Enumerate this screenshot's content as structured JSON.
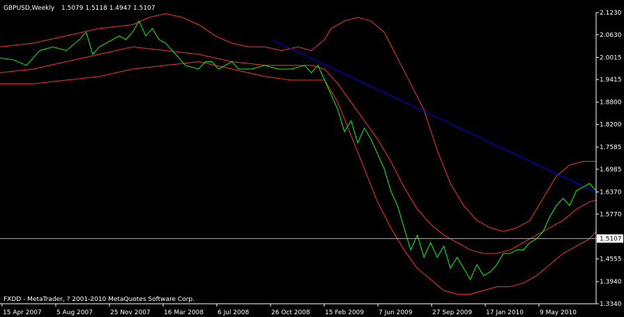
{
  "header": {
    "symbol": "GBPUSD,Weekly",
    "ohlc": "1.5079 1.5118 1.4947 1.5107"
  },
  "footer": {
    "copyright": "FXDD - MetaTrader, ? 2001-2010 MetaQuotes Software Corp."
  },
  "colors": {
    "background": "#000000",
    "price_line": "#00ff00",
    "bands": "#ff3030",
    "trendline": "#0000ff",
    "axis": "#ffffff"
  },
  "chart_data": {
    "type": "line",
    "ylim": [
      1.334,
      2.123
    ],
    "y_ticks": [
      "2.1230",
      "2.0630",
      "2.0015",
      "1.9415",
      "1.8800",
      "1.8200",
      "1.7585",
      "1.6985",
      "1.6370",
      "1.5770",
      "1.5107",
      "1.4555",
      "1.3940",
      "1.3340"
    ],
    "current_price": 1.5107,
    "current_price_label": "1.5107",
    "x_ticks": [
      "15 Apr 2007",
      "5 Aug 2007",
      "25 Nov 2007",
      "16 Mar 2008",
      "6 Jul 2008",
      "26 Oct 2008",
      "15 Feb 2009",
      "7 Jun 2009",
      "27 Sep 2009",
      "17 Jan 2010",
      "9 May 2010"
    ],
    "n_bars": 180,
    "series": [
      {
        "role": "price",
        "points": [
          [
            0,
            2.0
          ],
          [
            4,
            1.995
          ],
          [
            8,
            1.98
          ],
          [
            12,
            2.02
          ],
          [
            16,
            2.03
          ],
          [
            20,
            2.02
          ],
          [
            24,
            2.05
          ],
          [
            26,
            2.07
          ],
          [
            28,
            2.01
          ],
          [
            30,
            2.03
          ],
          [
            34,
            2.05
          ],
          [
            36,
            2.06
          ],
          [
            38,
            2.05
          ],
          [
            40,
            2.07
          ],
          [
            42,
            2.1
          ],
          [
            44,
            2.06
          ],
          [
            46,
            2.08
          ],
          [
            48,
            2.05
          ],
          [
            50,
            2.04
          ],
          [
            52,
            2.02
          ],
          [
            56,
            1.98
          ],
          [
            60,
            1.97
          ],
          [
            62,
            1.99
          ],
          [
            64,
            1.99
          ],
          [
            66,
            1.97
          ],
          [
            68,
            1.98
          ],
          [
            70,
            1.99
          ],
          [
            72,
            1.97
          ],
          [
            76,
            1.97
          ],
          [
            80,
            1.98
          ],
          [
            84,
            1.97
          ],
          [
            88,
            1.97
          ],
          [
            92,
            1.98
          ],
          [
            94,
            1.96
          ],
          [
            96,
            1.98
          ],
          [
            98,
            1.94
          ],
          [
            100,
            1.9
          ],
          [
            102,
            1.86
          ],
          [
            104,
            1.8
          ],
          [
            106,
            1.83
          ],
          [
            108,
            1.77
          ],
          [
            110,
            1.81
          ],
          [
            112,
            1.78
          ],
          [
            114,
            1.74
          ],
          [
            116,
            1.7
          ],
          [
            118,
            1.64
          ],
          [
            120,
            1.6
          ],
          [
            122,
            1.54
          ],
          [
            124,
            1.48
          ],
          [
            126,
            1.52
          ],
          [
            128,
            1.46
          ],
          [
            130,
            1.5
          ],
          [
            132,
            1.46
          ],
          [
            134,
            1.49
          ],
          [
            136,
            1.43
          ],
          [
            138,
            1.46
          ],
          [
            140,
            1.43
          ],
          [
            142,
            1.4
          ],
          [
            144,
            1.44
          ],
          [
            146,
            1.41
          ],
          [
            148,
            1.42
          ],
          [
            150,
            1.44
          ],
          [
            152,
            1.47
          ],
          [
            154,
            1.47
          ],
          [
            156,
            1.48
          ],
          [
            158,
            1.48
          ],
          [
            160,
            1.5
          ],
          [
            162,
            1.51
          ],
          [
            164,
            1.53
          ],
          [
            166,
            1.57
          ],
          [
            168,
            1.6
          ],
          [
            170,
            1.62
          ],
          [
            172,
            1.6
          ],
          [
            174,
            1.64
          ],
          [
            176,
            1.65
          ],
          [
            178,
            1.66
          ],
          [
            180,
            1.64
          ],
          [
            182,
            1.63
          ],
          [
            184,
            1.66
          ],
          [
            186,
            1.65
          ],
          [
            188,
            1.61
          ],
          [
            190,
            1.64
          ],
          [
            192,
            1.66
          ],
          [
            194,
            1.65
          ],
          [
            196,
            1.63
          ],
          [
            198,
            1.62
          ],
          [
            200,
            1.66
          ],
          [
            202,
            1.67
          ],
          [
            204,
            1.65
          ],
          [
            206,
            1.64
          ],
          [
            208,
            1.62
          ],
          [
            210,
            1.63
          ],
          [
            212,
            1.64
          ],
          [
            214,
            1.6
          ],
          [
            216,
            1.58
          ],
          [
            218,
            1.56
          ],
          [
            220,
            1.52
          ],
          [
            222,
            1.5
          ],
          [
            224,
            1.53
          ],
          [
            226,
            1.54
          ],
          [
            228,
            1.52
          ],
          [
            230,
            1.48
          ],
          [
            232,
            1.47
          ],
          [
            234,
            1.46
          ],
          [
            236,
            1.47
          ],
          [
            238,
            1.51
          ],
          [
            240,
            1.52
          ],
          [
            242,
            1.51
          ]
        ]
      },
      {
        "role": "upper-band",
        "points": [
          [
            0,
            2.03
          ],
          [
            10,
            2.04
          ],
          [
            20,
            2.06
          ],
          [
            30,
            2.08
          ],
          [
            40,
            2.09
          ],
          [
            45,
            2.11
          ],
          [
            50,
            2.12
          ],
          [
            55,
            2.11
          ],
          [
            60,
            2.09
          ],
          [
            65,
            2.06
          ],
          [
            70,
            2.04
          ],
          [
            75,
            2.03
          ],
          [
            80,
            2.03
          ],
          [
            85,
            2.02
          ],
          [
            90,
            2.03
          ],
          [
            94,
            2.02
          ],
          [
            98,
            2.05
          ],
          [
            100,
            2.08
          ],
          [
            104,
            2.1
          ],
          [
            108,
            2.11
          ],
          [
            112,
            2.1
          ],
          [
            116,
            2.07
          ],
          [
            120,
            2.0
          ],
          [
            124,
            1.93
          ],
          [
            128,
            1.86
          ],
          [
            132,
            1.75
          ],
          [
            136,
            1.66
          ],
          [
            140,
            1.6
          ],
          [
            144,
            1.56
          ],
          [
            148,
            1.54
          ],
          [
            152,
            1.53
          ],
          [
            156,
            1.54
          ],
          [
            160,
            1.56
          ],
          [
            164,
            1.62
          ],
          [
            168,
            1.68
          ],
          [
            172,
            1.71
          ],
          [
            176,
            1.72
          ],
          [
            180,
            1.72
          ],
          [
            184,
            1.7
          ],
          [
            188,
            1.68
          ],
          [
            192,
            1.68
          ],
          [
            196,
            1.69
          ],
          [
            200,
            1.68
          ],
          [
            204,
            1.67
          ],
          [
            208,
            1.67
          ],
          [
            212,
            1.68
          ],
          [
            216,
            1.69
          ],
          [
            220,
            1.68
          ],
          [
            224,
            1.67
          ],
          [
            228,
            1.65
          ],
          [
            232,
            1.62
          ],
          [
            236,
            1.58
          ],
          [
            240,
            1.56
          ]
        ]
      },
      {
        "role": "middle-band",
        "points": [
          [
            0,
            1.96
          ],
          [
            10,
            1.97
          ],
          [
            20,
            1.99
          ],
          [
            30,
            2.01
          ],
          [
            40,
            2.03
          ],
          [
            50,
            2.02
          ],
          [
            60,
            2.01
          ],
          [
            70,
            1.99
          ],
          [
            80,
            1.98
          ],
          [
            88,
            1.98
          ],
          [
            94,
            1.98
          ],
          [
            98,
            1.97
          ],
          [
            102,
            1.93
          ],
          [
            106,
            1.88
          ],
          [
            110,
            1.83
          ],
          [
            114,
            1.78
          ],
          [
            118,
            1.72
          ],
          [
            122,
            1.65
          ],
          [
            126,
            1.59
          ],
          [
            130,
            1.55
          ],
          [
            134,
            1.52
          ],
          [
            138,
            1.5
          ],
          [
            142,
            1.48
          ],
          [
            146,
            1.47
          ],
          [
            150,
            1.47
          ],
          [
            154,
            1.48
          ],
          [
            158,
            1.5
          ],
          [
            162,
            1.52
          ],
          [
            166,
            1.54
          ],
          [
            170,
            1.56
          ],
          [
            174,
            1.59
          ],
          [
            178,
            1.61
          ],
          [
            182,
            1.62
          ],
          [
            186,
            1.63
          ],
          [
            190,
            1.64
          ],
          [
            194,
            1.64
          ],
          [
            198,
            1.64
          ],
          [
            202,
            1.64
          ],
          [
            206,
            1.63
          ],
          [
            210,
            1.63
          ],
          [
            214,
            1.62
          ],
          [
            218,
            1.61
          ],
          [
            222,
            1.59
          ],
          [
            226,
            1.57
          ],
          [
            230,
            1.55
          ],
          [
            234,
            1.53
          ],
          [
            238,
            1.51
          ],
          [
            242,
            1.5
          ]
        ]
      },
      {
        "role": "lower-band",
        "points": [
          [
            0,
            1.93
          ],
          [
            10,
            1.93
          ],
          [
            20,
            1.94
          ],
          [
            30,
            1.95
          ],
          [
            40,
            1.97
          ],
          [
            50,
            1.98
          ],
          [
            60,
            1.99
          ],
          [
            70,
            1.97
          ],
          [
            80,
            1.95
          ],
          [
            88,
            1.94
          ],
          [
            94,
            1.94
          ],
          [
            98,
            1.94
          ],
          [
            102,
            1.88
          ],
          [
            106,
            1.79
          ],
          [
            110,
            1.7
          ],
          [
            114,
            1.61
          ],
          [
            118,
            1.54
          ],
          [
            122,
            1.48
          ],
          [
            126,
            1.43
          ],
          [
            130,
            1.4
          ],
          [
            134,
            1.37
          ],
          [
            138,
            1.36
          ],
          [
            142,
            1.36
          ],
          [
            146,
            1.37
          ],
          [
            150,
            1.38
          ],
          [
            154,
            1.38
          ],
          [
            158,
            1.39
          ],
          [
            162,
            1.41
          ],
          [
            166,
            1.44
          ],
          [
            170,
            1.47
          ],
          [
            174,
            1.49
          ],
          [
            178,
            1.51
          ],
          [
            182,
            1.55
          ],
          [
            186,
            1.58
          ],
          [
            190,
            1.6
          ],
          [
            194,
            1.6
          ],
          [
            198,
            1.6
          ],
          [
            202,
            1.59
          ],
          [
            206,
            1.58
          ],
          [
            210,
            1.58
          ],
          [
            214,
            1.57
          ],
          [
            218,
            1.56
          ],
          [
            222,
            1.53
          ],
          [
            226,
            1.5
          ],
          [
            230,
            1.47
          ],
          [
            234,
            1.44
          ],
          [
            238,
            1.43
          ],
          [
            242,
            1.43
          ]
        ]
      },
      {
        "role": "trendline",
        "points": [
          [
            82,
            2.05
          ],
          [
            250,
            1.34
          ]
        ]
      }
    ]
  }
}
